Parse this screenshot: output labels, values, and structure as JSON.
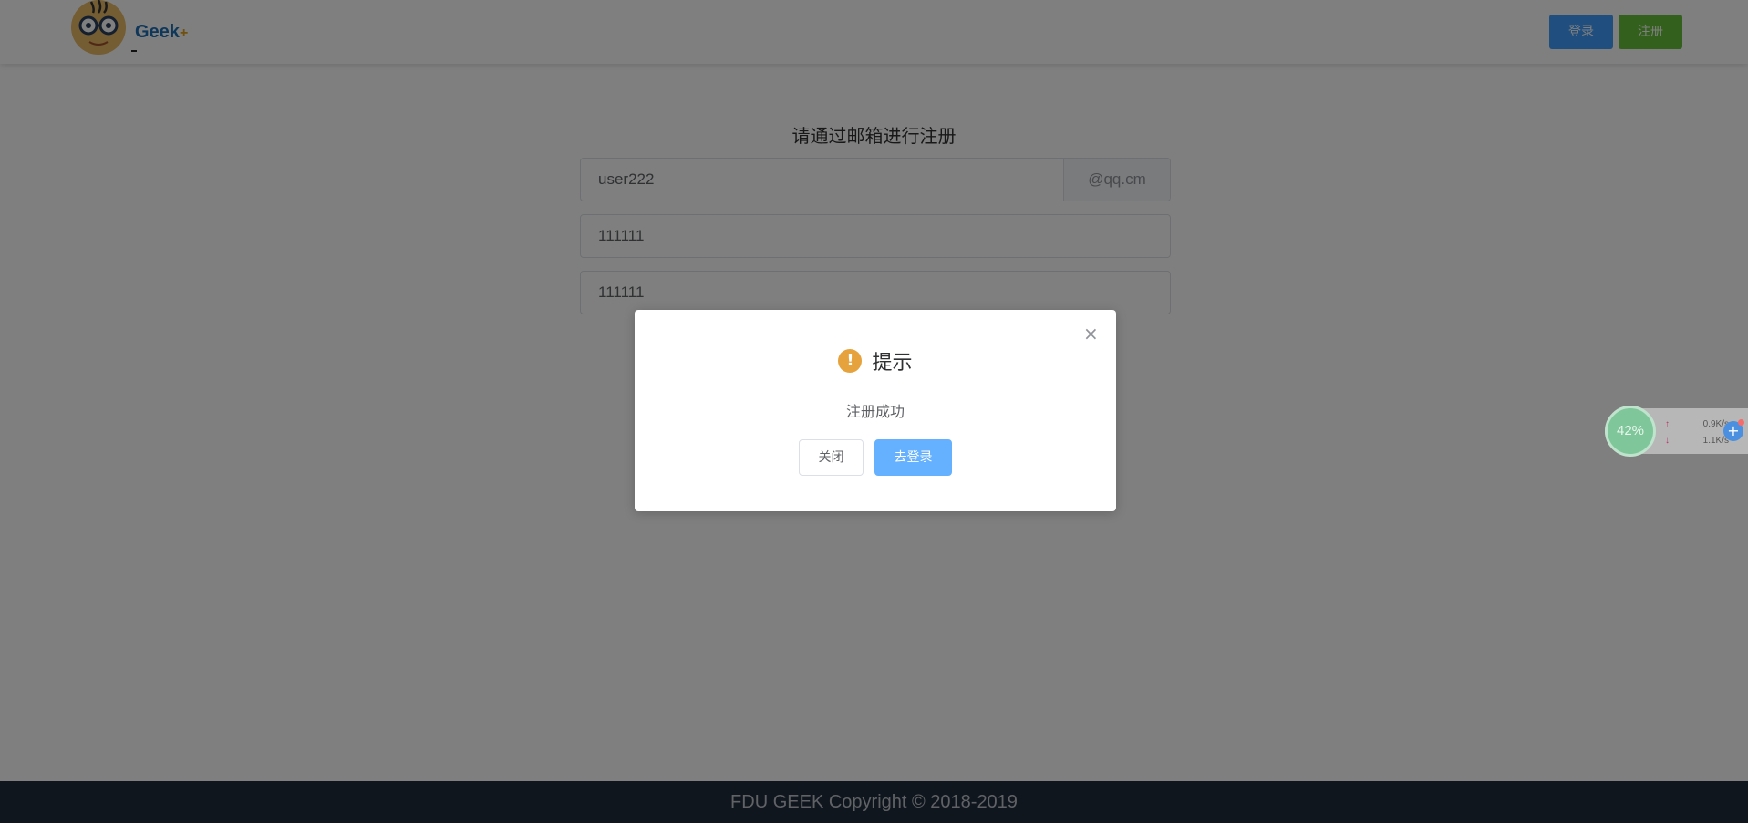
{
  "header": {
    "logo_text": "Geek",
    "logo_plus": "+",
    "login_label": "登录",
    "register_label": "注册"
  },
  "form": {
    "title": "请通过邮箱进行注册",
    "email_value": "user222",
    "email_suffix": "@qq.cm",
    "password_value": "111111",
    "confirm_password_value": "111111"
  },
  "footer": {
    "copyright": "FDU GEEK Copyright © 2018-2019"
  },
  "net_widget": {
    "percent": "42%",
    "upload_speed": "0.9K/s",
    "download_speed": "1.1K/s",
    "upload_arrow": "↑",
    "download_arrow": "↓"
  },
  "dialog": {
    "title": "提示",
    "message": "注册成功",
    "cancel_label": "关闭",
    "confirm_label": "去登录",
    "warn_icon": "!",
    "close_icon": "×"
  },
  "colors": {
    "primary": "#409eff",
    "success": "#67c23a",
    "warning": "#e6a23c",
    "footer_bg": "#1f2d3d"
  }
}
